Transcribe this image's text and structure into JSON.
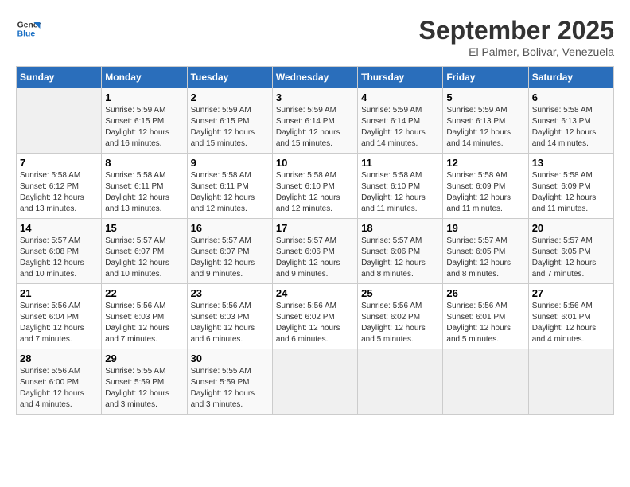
{
  "logo": {
    "line1": "General",
    "line2": "Blue"
  },
  "title": "September 2025",
  "subtitle": "El Palmer, Bolivar, Venezuela",
  "days_of_week": [
    "Sunday",
    "Monday",
    "Tuesday",
    "Wednesday",
    "Thursday",
    "Friday",
    "Saturday"
  ],
  "weeks": [
    [
      {
        "day": "",
        "info": ""
      },
      {
        "day": "1",
        "info": "Sunrise: 5:59 AM\nSunset: 6:15 PM\nDaylight: 12 hours\nand 16 minutes."
      },
      {
        "day": "2",
        "info": "Sunrise: 5:59 AM\nSunset: 6:15 PM\nDaylight: 12 hours\nand 15 minutes."
      },
      {
        "day": "3",
        "info": "Sunrise: 5:59 AM\nSunset: 6:14 PM\nDaylight: 12 hours\nand 15 minutes."
      },
      {
        "day": "4",
        "info": "Sunrise: 5:59 AM\nSunset: 6:14 PM\nDaylight: 12 hours\nand 14 minutes."
      },
      {
        "day": "5",
        "info": "Sunrise: 5:59 AM\nSunset: 6:13 PM\nDaylight: 12 hours\nand 14 minutes."
      },
      {
        "day": "6",
        "info": "Sunrise: 5:58 AM\nSunset: 6:13 PM\nDaylight: 12 hours\nand 14 minutes."
      }
    ],
    [
      {
        "day": "7",
        "info": "Sunrise: 5:58 AM\nSunset: 6:12 PM\nDaylight: 12 hours\nand 13 minutes."
      },
      {
        "day": "8",
        "info": "Sunrise: 5:58 AM\nSunset: 6:11 PM\nDaylight: 12 hours\nand 13 minutes."
      },
      {
        "day": "9",
        "info": "Sunrise: 5:58 AM\nSunset: 6:11 PM\nDaylight: 12 hours\nand 12 minutes."
      },
      {
        "day": "10",
        "info": "Sunrise: 5:58 AM\nSunset: 6:10 PM\nDaylight: 12 hours\nand 12 minutes."
      },
      {
        "day": "11",
        "info": "Sunrise: 5:58 AM\nSunset: 6:10 PM\nDaylight: 12 hours\nand 11 minutes."
      },
      {
        "day": "12",
        "info": "Sunrise: 5:58 AM\nSunset: 6:09 PM\nDaylight: 12 hours\nand 11 minutes."
      },
      {
        "day": "13",
        "info": "Sunrise: 5:58 AM\nSunset: 6:09 PM\nDaylight: 12 hours\nand 11 minutes."
      }
    ],
    [
      {
        "day": "14",
        "info": "Sunrise: 5:57 AM\nSunset: 6:08 PM\nDaylight: 12 hours\nand 10 minutes."
      },
      {
        "day": "15",
        "info": "Sunrise: 5:57 AM\nSunset: 6:07 PM\nDaylight: 12 hours\nand 10 minutes."
      },
      {
        "day": "16",
        "info": "Sunrise: 5:57 AM\nSunset: 6:07 PM\nDaylight: 12 hours\nand 9 minutes."
      },
      {
        "day": "17",
        "info": "Sunrise: 5:57 AM\nSunset: 6:06 PM\nDaylight: 12 hours\nand 9 minutes."
      },
      {
        "day": "18",
        "info": "Sunrise: 5:57 AM\nSunset: 6:06 PM\nDaylight: 12 hours\nand 8 minutes."
      },
      {
        "day": "19",
        "info": "Sunrise: 5:57 AM\nSunset: 6:05 PM\nDaylight: 12 hours\nand 8 minutes."
      },
      {
        "day": "20",
        "info": "Sunrise: 5:57 AM\nSunset: 6:05 PM\nDaylight: 12 hours\nand 7 minutes."
      }
    ],
    [
      {
        "day": "21",
        "info": "Sunrise: 5:56 AM\nSunset: 6:04 PM\nDaylight: 12 hours\nand 7 minutes."
      },
      {
        "day": "22",
        "info": "Sunrise: 5:56 AM\nSunset: 6:03 PM\nDaylight: 12 hours\nand 7 minutes."
      },
      {
        "day": "23",
        "info": "Sunrise: 5:56 AM\nSunset: 6:03 PM\nDaylight: 12 hours\nand 6 minutes."
      },
      {
        "day": "24",
        "info": "Sunrise: 5:56 AM\nSunset: 6:02 PM\nDaylight: 12 hours\nand 6 minutes."
      },
      {
        "day": "25",
        "info": "Sunrise: 5:56 AM\nSunset: 6:02 PM\nDaylight: 12 hours\nand 5 minutes."
      },
      {
        "day": "26",
        "info": "Sunrise: 5:56 AM\nSunset: 6:01 PM\nDaylight: 12 hours\nand 5 minutes."
      },
      {
        "day": "27",
        "info": "Sunrise: 5:56 AM\nSunset: 6:01 PM\nDaylight: 12 hours\nand 4 minutes."
      }
    ],
    [
      {
        "day": "28",
        "info": "Sunrise: 5:56 AM\nSunset: 6:00 PM\nDaylight: 12 hours\nand 4 minutes."
      },
      {
        "day": "29",
        "info": "Sunrise: 5:55 AM\nSunset: 5:59 PM\nDaylight: 12 hours\nand 3 minutes."
      },
      {
        "day": "30",
        "info": "Sunrise: 5:55 AM\nSunset: 5:59 PM\nDaylight: 12 hours\nand 3 minutes."
      },
      {
        "day": "",
        "info": ""
      },
      {
        "day": "",
        "info": ""
      },
      {
        "day": "",
        "info": ""
      },
      {
        "day": "",
        "info": ""
      }
    ]
  ]
}
